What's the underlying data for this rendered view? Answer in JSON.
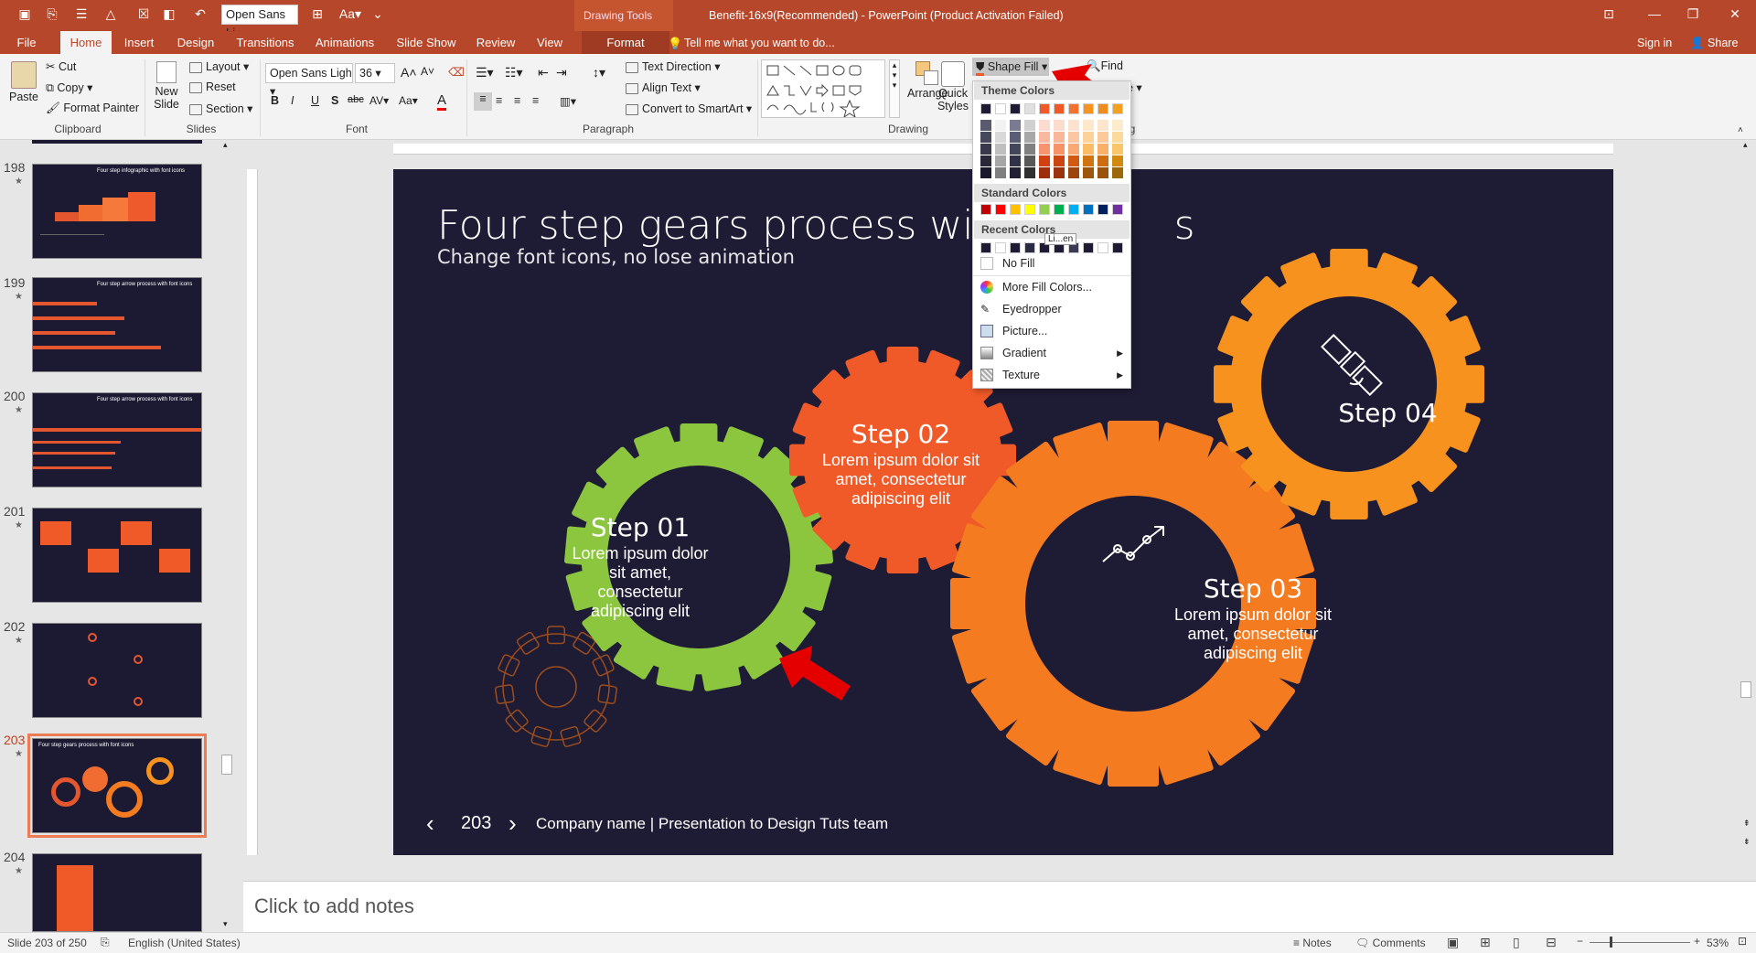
{
  "app": {
    "window_title": "Benefit-16x9(Recommended) - PowerPoint (Product Activation Failed)",
    "drawing_tools_label": "Drawing Tools",
    "font_name_qat": "Open Sans Li",
    "sign_in": "Sign in",
    "share": "Share",
    "tell_me": "Tell me what you want to do..."
  },
  "tabs": [
    "File",
    "Home",
    "Insert",
    "Design",
    "Transitions",
    "Animations",
    "Slide Show",
    "Review",
    "View",
    "Format"
  ],
  "ribbon": {
    "clipboard": {
      "group": "Clipboard",
      "paste": "Paste",
      "cut": "Cut",
      "copy": "Copy",
      "format_painter": "Format Painter"
    },
    "slides": {
      "group": "Slides",
      "new_slide_1": "New",
      "new_slide_2": "Slide",
      "layout": "Layout",
      "reset": "Reset",
      "section": "Section"
    },
    "font": {
      "group": "Font",
      "name": "Open Sans Ligh",
      "size": "36",
      "bold": "B",
      "italic": "I",
      "underline": "U",
      "shadow": "S",
      "strike": "abc",
      "spacing": "AV",
      "case": "Aa",
      "grow": "A",
      "shrink": "A"
    },
    "paragraph": {
      "group": "Paragraph",
      "text_direction": "Text Direction",
      "align_text": "Align Text",
      "convert_smartart": "Convert to SmartArt"
    },
    "drawing": {
      "group": "Drawing",
      "arrange": "Arrange",
      "quick_styles_1": "Quick",
      "quick_styles_2": "Styles",
      "shape_fill": "Shape Fill"
    },
    "editing": {
      "find": "Find",
      "group": "g"
    }
  },
  "shape_fill_menu": {
    "theme_colors_label": "Theme Colors",
    "standard_colors_label": "Standard Colors",
    "recent_colors_label": "Recent Colors",
    "tooltip": "Li...en",
    "items": [
      "No Fill",
      "More Fill Colors...",
      "Eyedropper",
      "Picture...",
      "Gradient",
      "Texture"
    ],
    "theme_top": [
      "#1e1b34",
      "#ffffff",
      "#1e1b34",
      "#e0e0e0",
      "#f05a28",
      "#f15a24",
      "#f3722c",
      "#f7931e",
      "#f08c1e",
      "#f4a21d"
    ],
    "theme_cols": [
      [
        "#5a5a6e",
        "#48485c",
        "#38384a",
        "#28283a",
        "#18182a"
      ],
      [
        "#f2f2f2",
        "#d9d9d9",
        "#bfbfbf",
        "#a6a6a6",
        "#808080"
      ],
      [
        "#7a7a90",
        "#5c5c74",
        "#44445a",
        "#303046",
        "#202032"
      ],
      [
        "#d0d0d0",
        "#a8a8a8",
        "#808080",
        "#585858",
        "#303030"
      ],
      [
        "#fcdcd0",
        "#f9b8a0",
        "#f69470",
        "#d04010",
        "#9c300c"
      ],
      [
        "#fcdccc",
        "#f9b89a",
        "#f69468",
        "#cc4410",
        "#993310"
      ],
      [
        "#fde2d0",
        "#fbc6a2",
        "#f9aa74",
        "#d05a12",
        "#9c440e"
      ],
      [
        "#fde8cc",
        "#fcd29a",
        "#fbbc68",
        "#d07410",
        "#9c570c"
      ],
      [
        "#fde4cc",
        "#fbca9a",
        "#f9b068",
        "#cc6e10",
        "#99530c"
      ],
      [
        "#fdeccc",
        "#fcd99c",
        "#fbc66a",
        "#d08a10",
        "#9c680c"
      ]
    ],
    "standard": [
      "#c00000",
      "#ff0000",
      "#ffc000",
      "#ffff00",
      "#92d050",
      "#00b050",
      "#00b0f0",
      "#0070c0",
      "#002060",
      "#7030a0"
    ],
    "recent": [
      "#1e1b34",
      "#ffffff",
      "#1e1b34",
      "#2a2a44",
      "#1e1b34",
      "#1e1b34",
      "#3a3a54",
      "#1e1b34",
      "#ffffff",
      "#1e1b34"
    ]
  },
  "thumbnails": [
    {
      "num": "198",
      "title": "Four step infographic with font icons"
    },
    {
      "num": "199",
      "title": "Four step arrow process with font icons"
    },
    {
      "num": "200",
      "title": "Four step arrow process with font icons"
    },
    {
      "num": "201",
      "title": ""
    },
    {
      "num": "202",
      "title": ""
    },
    {
      "num": "203",
      "title": "Four step gears process with font icons"
    },
    {
      "num": "204",
      "title": ""
    }
  ],
  "slide": {
    "title_left": "Four step gears process with ",
    "title_right": "s",
    "subtitle": "Change font icons, no lose animation",
    "page_number": "203",
    "footer": "Company name | Presentation to Design Tuts team",
    "steps": [
      {
        "label": "Step 01",
        "body_1": "Lorem ipsum dolor",
        "body_2": "sit amet,",
        "body_3": "consectetur",
        "body_4": "adipiscing elit",
        "color": "#8cc63f"
      },
      {
        "label": "Step 02",
        "body_1": "Lorem ipsum dolor sit",
        "body_2": "amet, consectetur",
        "body_3": "adipiscing elit",
        "color": "#f05a28"
      },
      {
        "label": "Step 03",
        "body_1": "Lorem ipsum dolor sit",
        "body_2": "amet, consectetur",
        "body_3": "adipiscing elit",
        "color": "#f47b20"
      },
      {
        "label": "Step 04",
        "color": "#f7921e"
      }
    ]
  },
  "notes_placeholder": "Click to add notes",
  "status": {
    "slide_of": "Slide 203 of 250",
    "language": "English (United States)",
    "notes": "Notes",
    "comments": "Comments",
    "zoom": "53%"
  },
  "colors": {
    "accent": "#b7472a",
    "slide_bg": "#1e1b34",
    "arrow": "#e50000"
  }
}
